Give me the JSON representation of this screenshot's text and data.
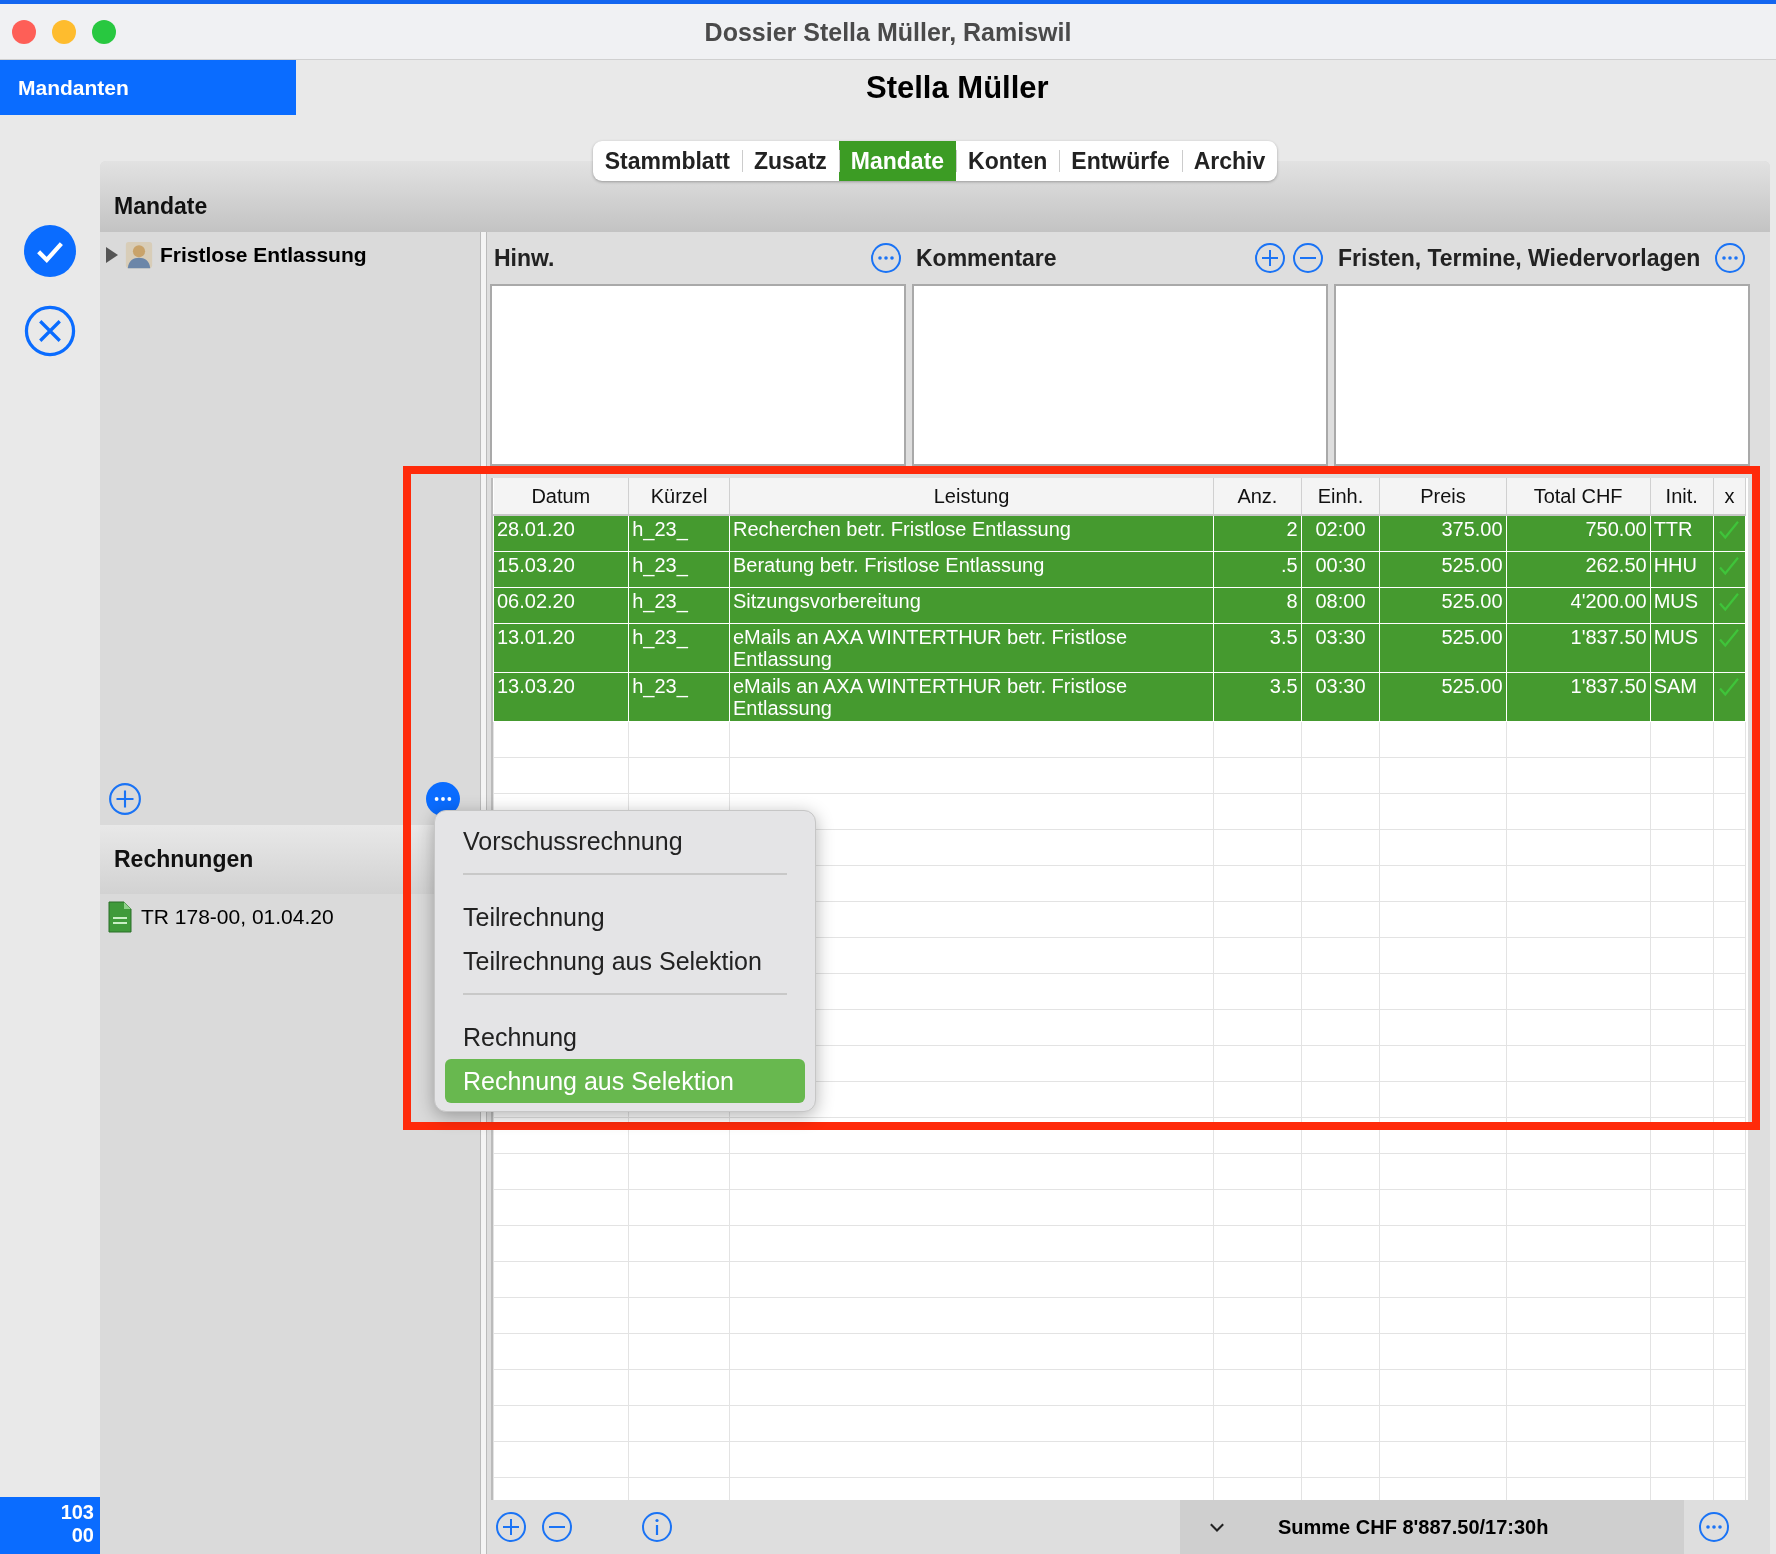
{
  "window": {
    "title": "Dossier Stella Müller, Ramiswil"
  },
  "nav_button": {
    "label": "Mandanten"
  },
  "client_name": "Stella Müller",
  "tabs": [
    {
      "label": "Stammblatt",
      "selected": false
    },
    {
      "label": "Zusatz",
      "selected": false
    },
    {
      "label": "Mandate",
      "selected": true
    },
    {
      "label": "Konten",
      "selected": false
    },
    {
      "label": "Entwürfe",
      "selected": false
    },
    {
      "label": "Archiv",
      "selected": false
    }
  ],
  "mandate_section": {
    "title": "Mandate",
    "items": [
      {
        "label": "Fristlose Entlassung",
        "expanded": false
      }
    ]
  },
  "invoice_section": {
    "title": "Rechnungen",
    "items": [
      {
        "label": "TR 178-00, 01.04.20"
      }
    ]
  },
  "counter": {
    "lines": [
      "103",
      "00"
    ]
  },
  "notes_panels": [
    {
      "title": "Hinw."
    },
    {
      "title": "Kommentare"
    },
    {
      "title": "Fristen, Termine, Wiedervorlagen"
    }
  ],
  "table": {
    "columns": [
      "Datum",
      "Kürzel",
      "Leistung",
      "Anz.",
      "Einh.",
      "Preis",
      "Total CHF",
      "Init.",
      "x"
    ],
    "rows": [
      {
        "cells": [
          "28.01.20",
          "h_23_",
          "Recherchen betr. Fristlose Entlassung",
          "2",
          "02:00",
          "375.00",
          "750.00",
          "TTR"
        ],
        "selected": true,
        "checked": true
      },
      {
        "cells": [
          "15.03.20",
          "h_23_",
          "Beratung betr. Fristlose Entlassung",
          ".5",
          "00:30",
          "525.00",
          "262.50",
          "HHU"
        ],
        "selected": true,
        "checked": true
      },
      {
        "cells": [
          "06.02.20",
          "h_23_",
          "Sitzungsvorbereitung",
          "8",
          "08:00",
          "525.00",
          "4'200.00",
          "MUS"
        ],
        "selected": true,
        "checked": true
      },
      {
        "cells": [
          "13.01.20",
          "h_23_",
          "eMails an AXA WINTERTHUR betr. Fristlose Entlassung",
          "3.5",
          "03:30",
          "525.00",
          "1'837.50",
          "MUS"
        ],
        "selected": true,
        "checked": true
      },
      {
        "cells": [
          "13.03.20",
          "h_23_",
          "eMails an AXA WINTERTHUR betr. Fristlose Entlassung",
          "3.5",
          "03:30",
          "525.00",
          "1'837.50",
          "SAM"
        ],
        "selected": true,
        "checked": true
      }
    ]
  },
  "context_menu": {
    "groups": [
      {
        "items": [
          {
            "label": "Vorschussrechnung",
            "selected": false
          }
        ]
      },
      {
        "items": [
          {
            "label": "Teilrechnung",
            "selected": false
          },
          {
            "label": "Teilrechnung aus Selektion",
            "selected": false
          }
        ]
      },
      {
        "items": [
          {
            "label": "Rechnung",
            "selected": false
          },
          {
            "label": "Rechnung aus Selektion",
            "selected": true
          }
        ]
      }
    ]
  },
  "footer": {
    "sum": "Summe CHF 8'887.50/17:30h"
  }
}
